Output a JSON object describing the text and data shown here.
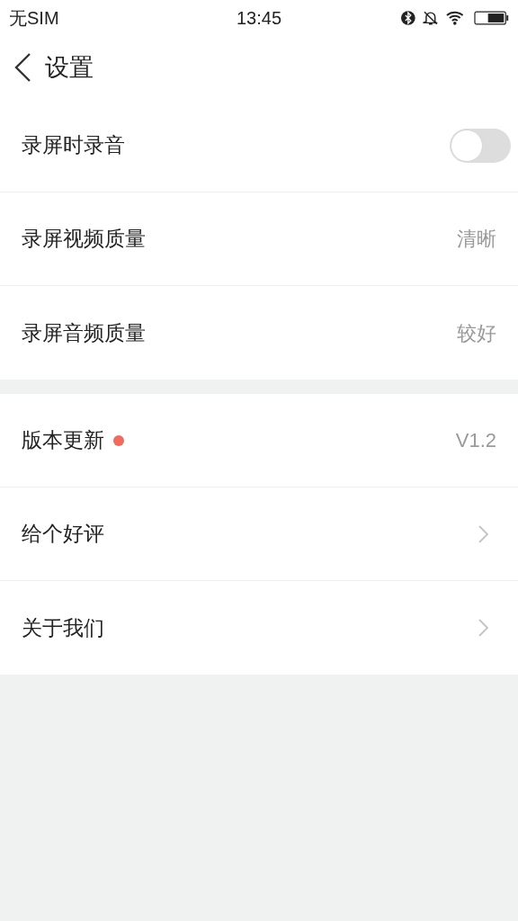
{
  "status_bar": {
    "carrier": "无SIM",
    "time": "13:45"
  },
  "header": {
    "title": "设置"
  },
  "sections": [
    {
      "rows": [
        {
          "kind": "toggle",
          "label": "录屏时录音",
          "on": false
        },
        {
          "kind": "value",
          "label": "录屏视频质量",
          "value": "清晰"
        },
        {
          "kind": "value",
          "label": "录屏音频质量",
          "value": "较好"
        }
      ]
    },
    {
      "rows": [
        {
          "kind": "value",
          "label": "版本更新",
          "value": "V1.2",
          "badge": true
        },
        {
          "kind": "link",
          "label": "给个好评"
        },
        {
          "kind": "link",
          "label": "关于我们"
        }
      ]
    }
  ]
}
